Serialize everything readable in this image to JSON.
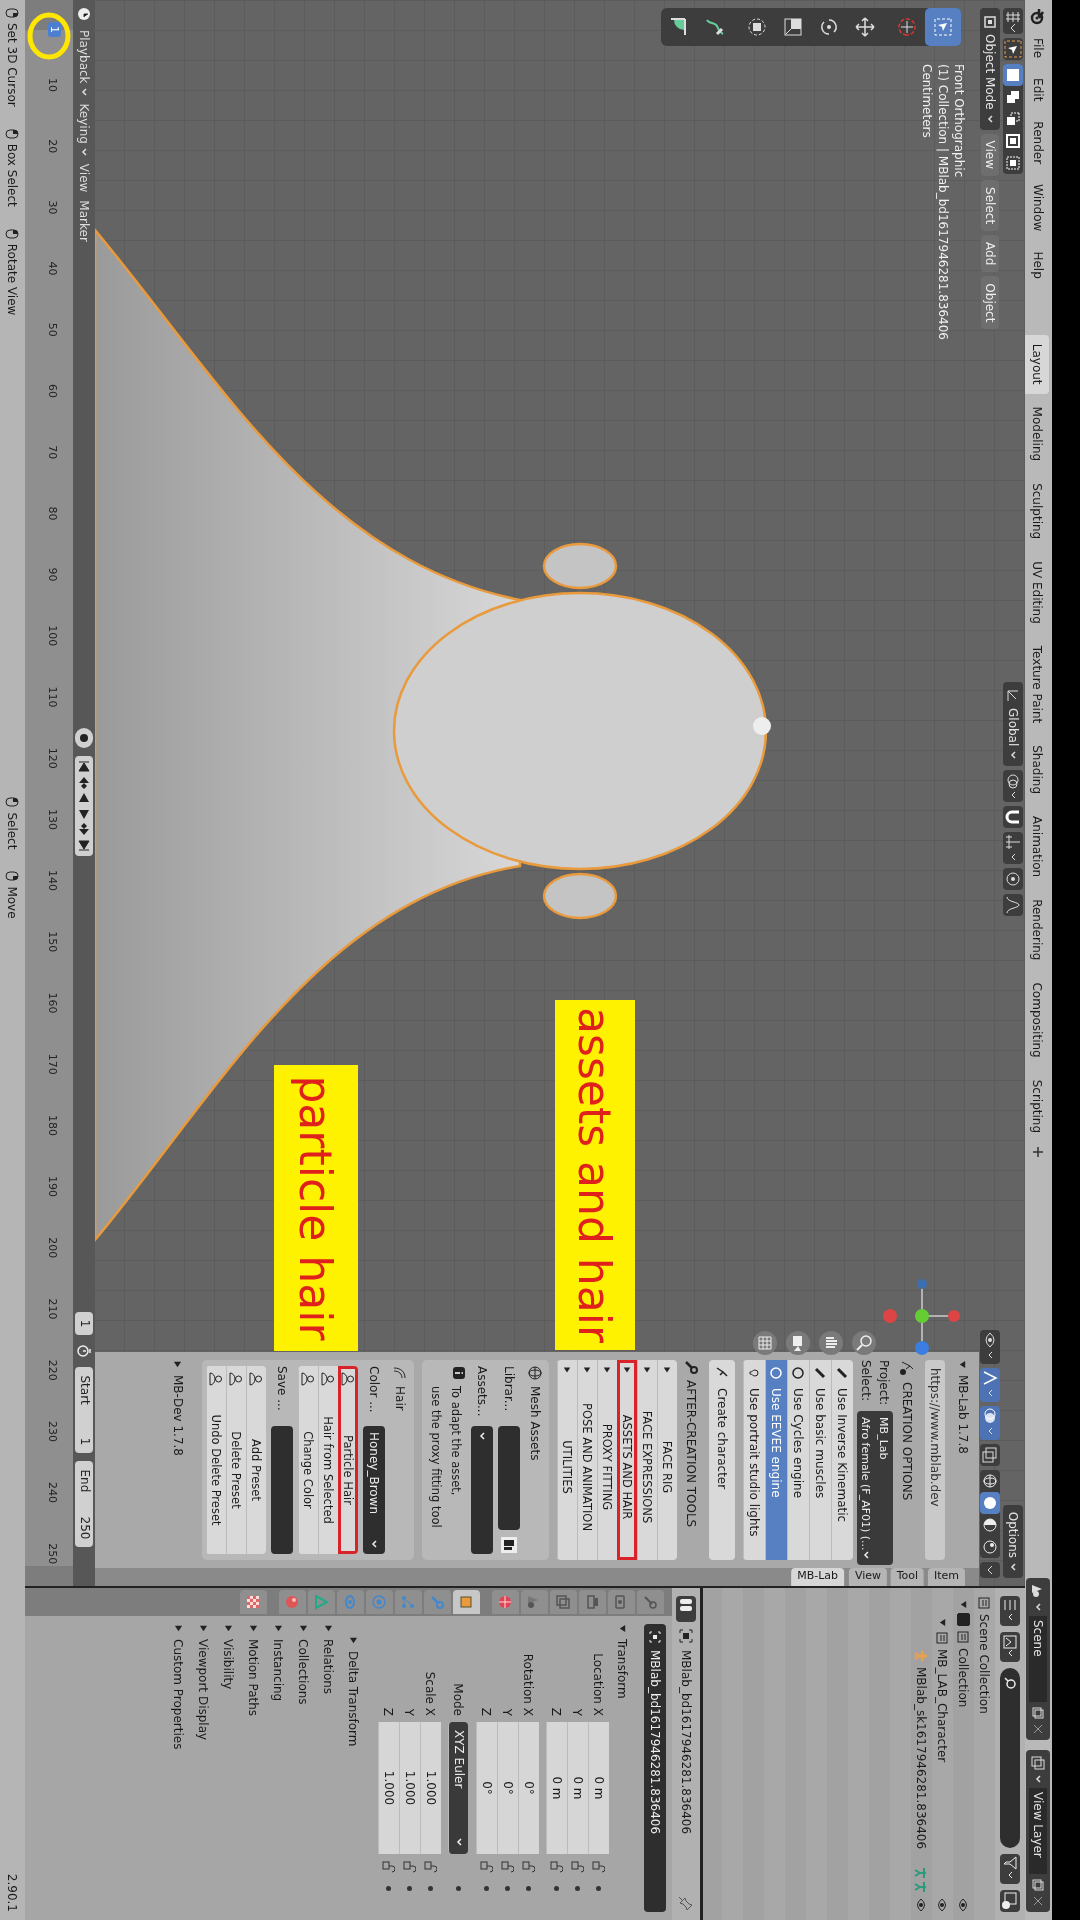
{
  "topbar": {
    "menus": [
      "File",
      "Edit",
      "Render",
      "Window",
      "Help"
    ],
    "workspaces": [
      {
        "label": "Layout",
        "selected": true
      },
      {
        "label": "Modeling",
        "selected": false
      },
      {
        "label": "Sculpting",
        "selected": false
      },
      {
        "label": "UV Editing",
        "selected": false
      },
      {
        "label": "Texture Paint",
        "selected": false
      },
      {
        "label": "Shading",
        "selected": false
      },
      {
        "label": "Animation",
        "selected": false
      },
      {
        "label": "Rendering",
        "selected": false
      },
      {
        "label": "Compositing",
        "selected": false
      },
      {
        "label": "Scripting",
        "selected": false
      }
    ],
    "scene": "Scene",
    "view_layer": "View Layer"
  },
  "viewport": {
    "select_modes": [
      {
        "kind": "set",
        "selected": true
      },
      {
        "kind": "extend",
        "selected": false
      },
      {
        "kind": "subtract",
        "selected": false
      },
      {
        "kind": "difference",
        "selected": false
      },
      {
        "kind": "intersect",
        "selected": false
      }
    ],
    "orientation": "Global",
    "options": "Options",
    "mode": "Object Mode",
    "menus": [
      "View",
      "Select",
      "Add",
      "Object"
    ],
    "shading_modes": [
      {
        "kind": "wireframe",
        "selected": false
      },
      {
        "kind": "solid",
        "selected": true
      },
      {
        "kind": "material",
        "selected": false
      },
      {
        "kind": "rendered",
        "selected": false
      }
    ],
    "tools": [
      {
        "kind": "select_box",
        "selected": true
      },
      {
        "kind": "cursor",
        "selected": false
      },
      {
        "kind": "move",
        "selected": false
      },
      {
        "kind": "rotate",
        "selected": false
      },
      {
        "kind": "scale",
        "selected": false
      },
      {
        "kind": "transform",
        "selected": false
      },
      {
        "kind": "annotate",
        "selected": false
      },
      {
        "kind": "measure",
        "selected": false
      }
    ],
    "overlay_text": [
      "Front Orthographic",
      "(1) Collection | MBlab_bd1617946281.836406",
      "Centimeters"
    ],
    "annotations": [
      {
        "text": "assets and hair"
      },
      {
        "text": "particle hair"
      }
    ]
  },
  "sidebar": {
    "tabs": [
      {
        "label": "MB-Lab",
        "selected": true
      },
      {
        "label": "View",
        "selected": false
      },
      {
        "label": "Tool",
        "selected": false
      },
      {
        "label": "Item",
        "selected": false
      }
    ],
    "title": "MB-Lab 1.7.8",
    "url": "https://www.mblab.dev",
    "creation_title": "CREATION OPTIONS",
    "project_label": "Project:",
    "project_value": "MB_Lab",
    "select_label": "Select:",
    "select_value": "Afro female (F_AF01) (...",
    "toggles": [
      {
        "label": "Use Inverse Kinematic",
        "on": false
      },
      {
        "label": "Use basic muscles",
        "on": false
      },
      {
        "label": "Use Cycles engine",
        "on": false
      },
      {
        "label": "Use EEVEE engine",
        "on": true
      },
      {
        "label": "Use portrait studio lights",
        "on": false
      }
    ],
    "create_button": "Create character",
    "after_title": "AFTER-CREATION TOOLS",
    "tools": [
      {
        "label": "FACE RIG",
        "highlighted": false
      },
      {
        "label": "FACE EXPRESSIONS",
        "highlighted": false
      },
      {
        "label": "ASSETS AND HAIR",
        "highlighted": true
      },
      {
        "label": "PROXY FITTING",
        "highlighted": false
      },
      {
        "label": "POSE AND ANIMATION",
        "highlighted": false
      },
      {
        "label": "UTILITIES",
        "highlighted": false
      }
    ],
    "mesh_assets": {
      "title": "Mesh Assets",
      "library_label": "Librar...",
      "assets_label": "Assets...",
      "info": [
        "To adapt the asset,",
        "use the proxy fitting tool"
      ]
    },
    "hair": {
      "title": "Hair",
      "color_label": "Color ...",
      "color_value": "Honey_Brown",
      "buttons": [
        {
          "label": "Particle Hair",
          "highlighted": true
        },
        {
          "label": "Hair from Selected",
          "highlighted": false
        },
        {
          "label": "Change Color",
          "highlighted": false
        }
      ],
      "save_label": "Save ...",
      "presets": [
        "Add Preset",
        "Delete Preset",
        "Undo Delete Preset"
      ]
    },
    "dev_panel": {
      "title": "MB-Dev 1.7.8",
      "expanded": false
    }
  },
  "outliner": {
    "root": "Scene Collection",
    "tree": [
      {
        "label": "Collection",
        "kind": "collection",
        "checked": true,
        "expanded": true,
        "children": [
          {
            "label": "MB_LAB_Character",
            "kind": "collection",
            "expanded": true,
            "children": [
              {
                "label": "MBlab_sk1617946281.836406",
                "kind": "armature"
              }
            ]
          }
        ]
      }
    ]
  },
  "properties": {
    "header_name": "MBlab_bd1617946281.836406",
    "object_name": "MBlab_bd1617946281.836406",
    "tabs": [
      {
        "kind": "tool",
        "selected": false
      },
      {
        "kind": "render",
        "selected": false
      },
      {
        "kind": "output",
        "selected": false
      },
      {
        "kind": "view_layer",
        "selected": false
      },
      {
        "kind": "scene",
        "selected": false
      },
      {
        "kind": "world",
        "selected": false
      },
      {
        "kind": "object",
        "selected": true
      },
      {
        "kind": "modifiers",
        "selected": false
      },
      {
        "kind": "particles",
        "selected": false
      },
      {
        "kind": "physics",
        "selected": false
      },
      {
        "kind": "constraints",
        "selected": false
      },
      {
        "kind": "data",
        "selected": false
      },
      {
        "kind": "material",
        "selected": false
      },
      {
        "kind": "texture",
        "selected": false
      }
    ],
    "transform": {
      "title": "Transform",
      "expanded": true,
      "groups": [
        {
          "kind": "fields",
          "rows": [
            {
              "label": "Location X",
              "value": "0 m"
            },
            {
              "label": "Y",
              "value": "0 m"
            },
            {
              "label": "Z",
              "value": "0 m"
            }
          ]
        },
        {
          "kind": "fields",
          "rows": [
            {
              "label": "Rotation X",
              "value": "0°"
            },
            {
              "label": "Y",
              "value": "0°"
            },
            {
              "label": "Z",
              "value": "0°"
            }
          ]
        },
        {
          "kind": "dropdown",
          "label": "Mode",
          "value": "XYZ Euler"
        },
        {
          "kind": "fields",
          "rows": [
            {
              "label": "Scale X",
              "value": "1.000"
            },
            {
              "label": "Y",
              "value": "1.000"
            },
            {
              "label": "Z",
              "value": "1.000"
            }
          ]
        }
      ]
    },
    "panels": [
      {
        "title": "Delta Transform",
        "expanded": false
      },
      {
        "title": "Relations",
        "expanded": false
      },
      {
        "title": "Collections",
        "expanded": false
      },
      {
        "title": "Instancing",
        "expanded": false
      },
      {
        "title": "Motion Paths",
        "expanded": false
      },
      {
        "title": "Visibility",
        "expanded": false
      },
      {
        "title": "Viewport Display",
        "expanded": false
      },
      {
        "title": "Custom Properties",
        "expanded": false
      }
    ]
  },
  "timeline": {
    "menus": [
      {
        "label": "Playback",
        "dropdown": true
      },
      {
        "label": "Keying",
        "dropdown": true
      },
      {
        "label": "View",
        "dropdown": false
      },
      {
        "label": "Marker",
        "dropdown": false
      }
    ],
    "current_frame": "1",
    "start_label": "Start",
    "start": "1",
    "end_label": "End",
    "end": "250",
    "frame_marker": "1",
    "ruler": [
      "10",
      "20",
      "30",
      "40",
      "50",
      "60",
      "70",
      "80",
      "90",
      "100",
      "110",
      "120",
      "130",
      "140",
      "150",
      "160",
      "170",
      "180",
      "190",
      "200",
      "210",
      "220",
      "230",
      "240",
      "250"
    ]
  },
  "status_bar": {
    "hints": [
      "Set 3D Cursor",
      "Box Select",
      "Rotate View",
      "Select",
      "Move"
    ],
    "version": "2.90.1"
  }
}
